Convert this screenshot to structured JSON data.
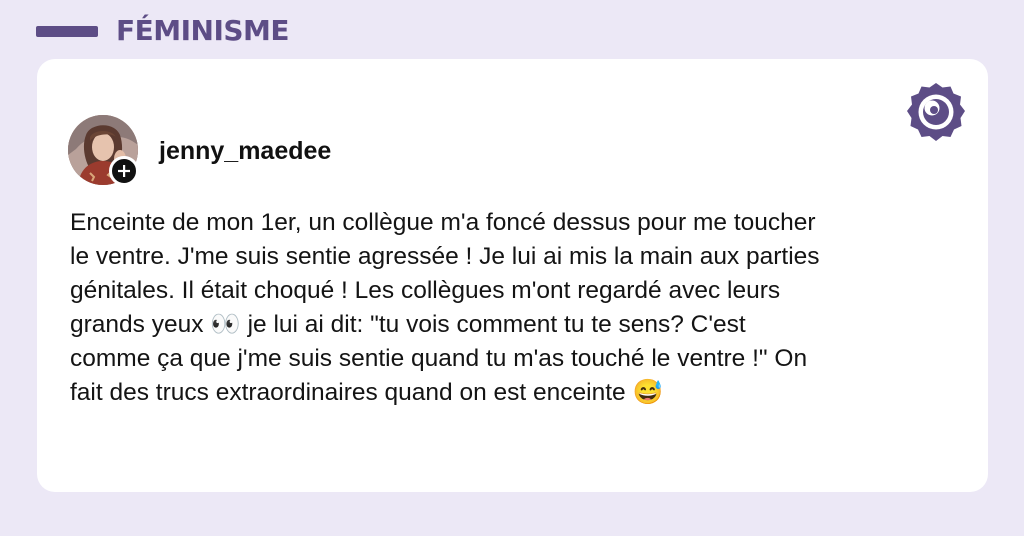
{
  "header": {
    "category": "FÉMINISME"
  },
  "post": {
    "username": "jenny_maedee",
    "text": "Enceinte de mon 1er, un collègue m'a foncé dessus pour me toucher\nle ventre. J'me suis sentie agressée ! Je lui ai mis la main aux parties\ngénitales. Il était choqué ! Les collègues m'ont regardé avec leurs\ngrands yeux 👀 je lui ai dit: \"tu vois comment tu te sens? C'est\ncomme ça que j'me suis sentie quand tu m'as touché le ventre !\" On\nfait des trucs extraordinaires quand on est enceinte 😅"
  },
  "icons": {
    "follow": "plus-icon",
    "brand": "madmoizelle-logo-icon",
    "avatar": "avatar-photo"
  },
  "colors": {
    "background": "#ece8f6",
    "accent": "#5d4d86",
    "card": "#ffffff",
    "text": "#141414"
  }
}
